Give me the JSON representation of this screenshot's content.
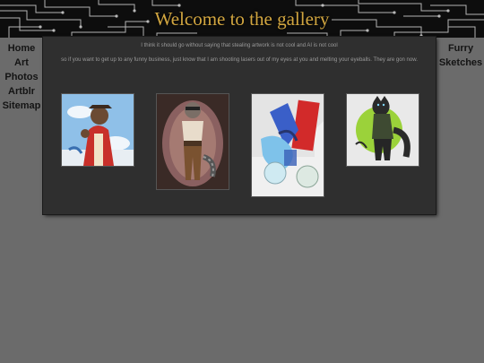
{
  "header": {
    "title": "Welcome to the gallery"
  },
  "nav_left": [
    {
      "label": "Home"
    },
    {
      "label": "Art"
    },
    {
      "label": "Photos"
    },
    {
      "label": "Artblr"
    },
    {
      "label": "Sitemap"
    }
  ],
  "nav_right": [
    {
      "label": "Furry"
    },
    {
      "label": "Sketches"
    }
  ],
  "panel": {
    "notice_1": "I think it should go without saying that stealing artwork is not cool and AI is not cool",
    "notice_2": "so if you want to get up to any funny business, just know that I am shooting lasers out of my eyes at you and melting your eyeballs. They are gon now."
  },
  "colors": {
    "page_bg": "#6b6b6b",
    "panel_bg": "#2f2f2f",
    "title": "#d2a640",
    "header_bg": "#0d0d0d"
  },
  "gallery": [
    {
      "name": "pirate-bear-artwork"
    },
    {
      "name": "steampunk-raccoon-artwork"
    },
    {
      "name": "blue-fox-dragon-artwork"
    },
    {
      "name": "black-wolf-artwork"
    }
  ]
}
